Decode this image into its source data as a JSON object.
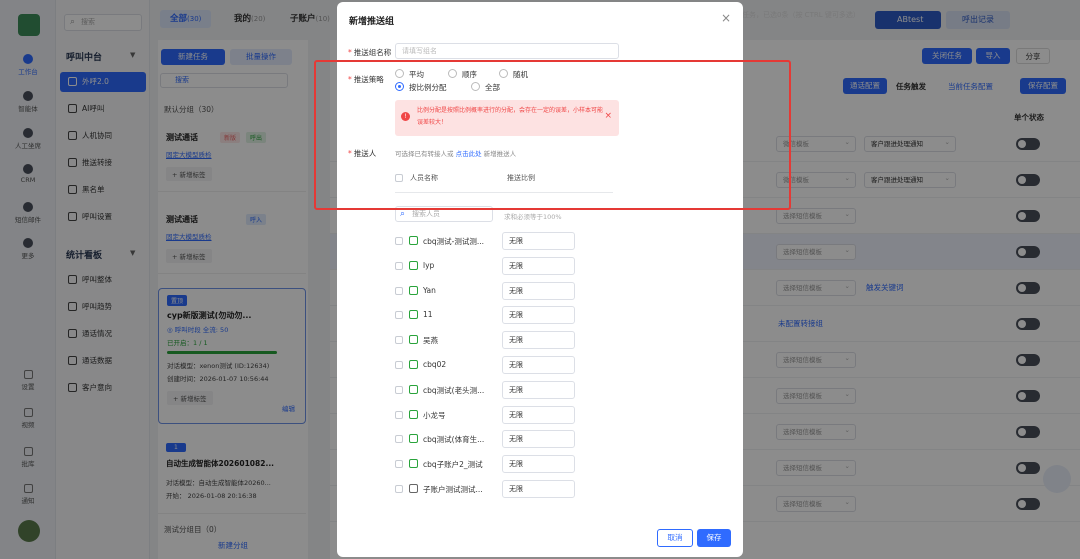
{
  "rail": {
    "items": [
      "工作台",
      "智能体",
      "人工坐席",
      "CRM",
      "短信邮件",
      "更多"
    ],
    "bottom_items": [
      "设置",
      "视频",
      "批库",
      "通知"
    ]
  },
  "sidebar": {
    "search_placeholder": "搜索",
    "group1": "呼叫中台",
    "nav1": [
      "外呼2.0",
      "AI呼叫",
      "人机协同",
      "推送转接",
      "黑名单",
      "呼叫设置"
    ],
    "group2": "统计看板",
    "nav2": [
      "呼叫整体",
      "呼叫趋势",
      "通话情况",
      "通话数据",
      "客户意向"
    ]
  },
  "tabs": [
    {
      "label": "全部",
      "count": "(30)"
    },
    {
      "label": "我的",
      "count": "(20)"
    },
    {
      "label": "子账户",
      "count": "(10)"
    }
  ],
  "list": {
    "new_task": "新建任务",
    "batch": "批量操作",
    "search_placeholder": "搜索",
    "default_group": "默认分组（30）",
    "cards": [
      {
        "title": "测试通话",
        "badges": [
          "新版",
          "呼出"
        ],
        "link": "固定大模型质检",
        "tag": "+ 新增标签"
      },
      {
        "title": "测试通话",
        "badges": [
          "呼入"
        ],
        "link": "固定大模型质检",
        "tag": "+ 新增标签"
      },
      {
        "top": "置顶",
        "title": "cyp新版测试(勿动勿...",
        "badges": [
          "新版",
          "呼出"
        ],
        "stats": "◎ 呼叫时段   全流: 50",
        "progress": "已开启：1 / 1",
        "model": "对话模型：xenon测试 (ID:12634)",
        "created": "创建时间：2026-01-07 10:56:44",
        "tag": "+ 新增标签",
        "edit": "编辑"
      },
      {
        "top": "1",
        "title": "自动生成智能体202601082...",
        "badges": [
          "呼入"
        ],
        "model": "对话模型：自动生成智能体20260...",
        "start": "开始：   2026-01-08 20:16:38"
      }
    ],
    "test_group": "测试分组目（0）",
    "new_group": "新建分组"
  },
  "toolbar": {
    "selected": "任务，已选0条（按 CTRL 键可多选）",
    "abtest": "ABtest",
    "export": "呼出记录",
    "close_task": "关闭任务",
    "import": "导入",
    "share": "分享",
    "channel_config": "通话配置",
    "task_trigger": "任务触发",
    "current_config": "当前任务配置",
    "save_config": "保存配置",
    "single_status": "单个状态"
  },
  "grid_rows": [
    {
      "select1": "微信模板",
      "select2": "客户跟进处理通知"
    },
    {
      "select1": "微信模板",
      "select2": "客户跟进处理通知"
    },
    {
      "select1": "选择短信模板"
    },
    {
      "select1": "选择短信模板"
    },
    {
      "select1": "选择短信模板",
      "link": "触发关键词"
    },
    {
      "link": "未配置转接组"
    },
    {
      "select1": "选择短信模板"
    },
    {
      "select1": "选择短信模板"
    },
    {
      "select1": "选择短信模板"
    },
    {
      "select1": "选择短信模板"
    },
    {
      "select1": "选择短信模板"
    }
  ],
  "modal": {
    "title": "新增推送组",
    "close": "×",
    "name_label": "推送组名称",
    "name_placeholder": "请填写组名",
    "strategy_label": "推送策略",
    "options_row1": [
      "平均",
      "顺序",
      "随机"
    ],
    "options_row2": [
      "按比例分配",
      "全部"
    ],
    "warning": "比例分配是按照比例概率进行的分配，会存在一定的误差，小样本可能误差较大！",
    "pusher_label": "推送人",
    "hint_prefix": "可选择已有转接人或",
    "hint_link": "点击此处",
    "hint_suffix": "新增推送人",
    "col_name": "人员名称",
    "col_ratio": "推送比例",
    "search_placeholder": "搜索人员",
    "ratio_hint": "求和必须等于100%",
    "people": [
      {
        "name": "cbq测试-测试测...",
        "ratio": "无限"
      },
      {
        "name": "lyp",
        "ratio": "无限"
      },
      {
        "name": "Yan",
        "ratio": "无限"
      },
      {
        "name": "11",
        "ratio": "无限"
      },
      {
        "name": "吴燕",
        "ratio": "无限"
      },
      {
        "name": "cbq02",
        "ratio": "无限"
      },
      {
        "name": "cbq测试(老头测...",
        "ratio": "无限"
      },
      {
        "name": "小龙号",
        "ratio": "无限"
      },
      {
        "name": "cbq测试(体育生...",
        "ratio": "无限"
      },
      {
        "name": "cbq子账户2_测试",
        "ratio": "无限"
      },
      {
        "name": "子账户测试测试...",
        "ratio": "无限"
      }
    ],
    "cancel": "取消",
    "save": "保存"
  }
}
